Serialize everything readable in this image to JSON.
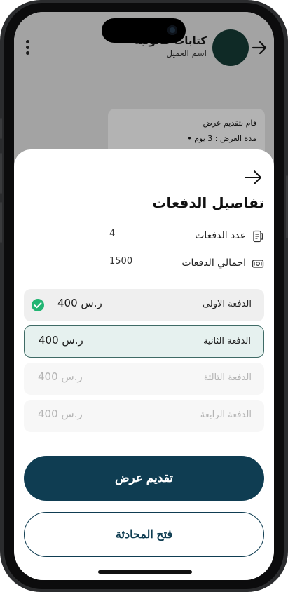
{
  "header": {
    "title": "كتابات قانونية",
    "subtitle": "اسم العميل"
  },
  "chat_card": {
    "line1": "قام بتقديم عرض",
    "line2": "•  مدة العرض :  3 يوم"
  },
  "sheet": {
    "title": "تفاصيل الدفعات",
    "info": [
      {
        "label": "عدد الدفعات",
        "value": "4",
        "icon": "receipt-icon"
      },
      {
        "label": "اجمالي الدفعات",
        "value": "1500",
        "icon": "cash-icon"
      }
    ],
    "payments": [
      {
        "label": "الدفعة الاولى",
        "amount": "400 ر.س",
        "status": "paid"
      },
      {
        "label": "الدفعة الثانية",
        "amount": "400 ر.س",
        "status": "current"
      },
      {
        "label": "الدفعة الثالثة",
        "amount": "400 ر.س",
        "status": "upcoming"
      },
      {
        "label": "الدفعة الرابعة",
        "amount": "400 ر.س",
        "status": "upcoming"
      }
    ],
    "primary_button": "تقديم عرض",
    "secondary_button": "فتح المحادثة"
  },
  "colors": {
    "primary": "#0f3d52",
    "active_row_bg": "#e6f1ef",
    "check_green": "#22b573"
  }
}
